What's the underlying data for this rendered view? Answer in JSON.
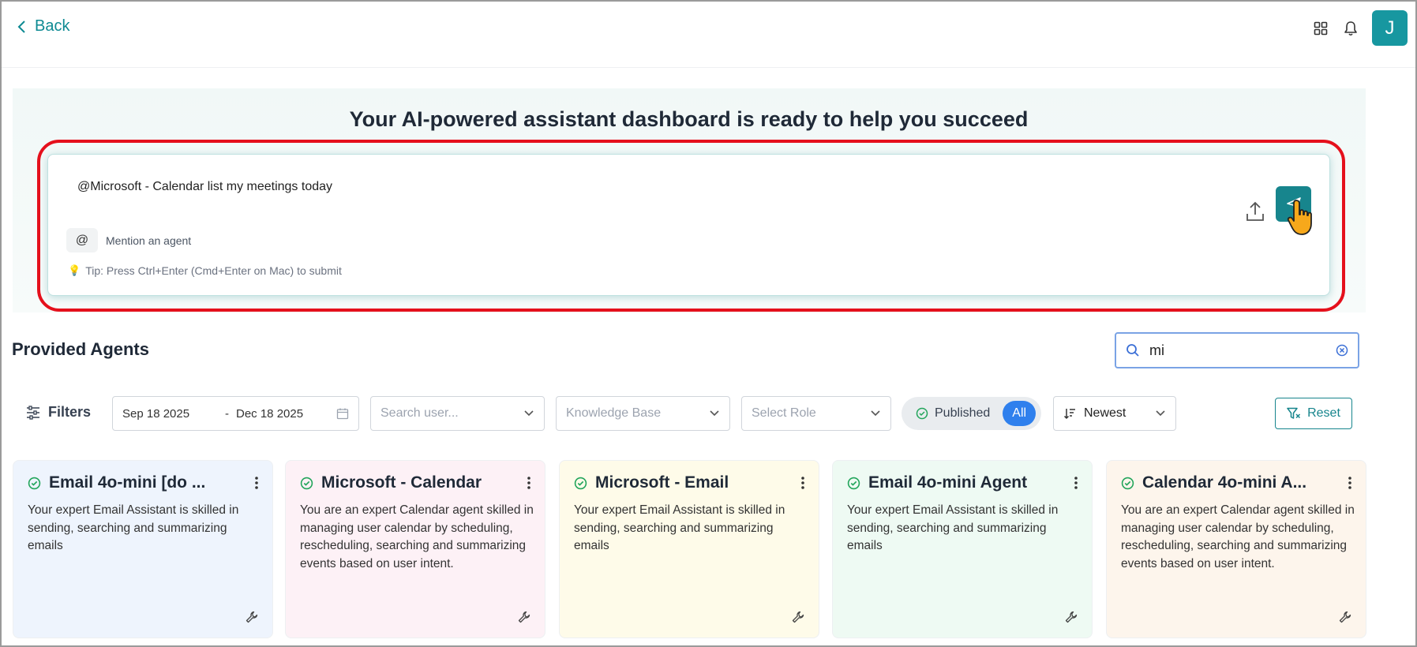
{
  "header": {
    "back_label": "Back",
    "avatar_initial": "J",
    "icons": [
      "grid-icon",
      "bell-icon"
    ]
  },
  "hero": {
    "title": "Your AI-powered assistant dashboard is ready to help you succeed",
    "composer_value": "@Microsoft - Calendar list my meetings today",
    "mention_symbol": "@",
    "mention_label": "Mention an agent",
    "tip": "Tip: Press Ctrl+Enter (Cmd+Enter on Mac) to submit"
  },
  "agents_section": {
    "title": "Provided Agents",
    "search_value": "mi"
  },
  "filters": {
    "label": "Filters",
    "date_start": "Sep 18 2025",
    "date_separator": "-",
    "date_end": "Dec 18 2025",
    "user_placeholder": "Search user...",
    "kb_placeholder": "Knowledge Base",
    "role_placeholder": "Select Role",
    "published_label": "Published",
    "all_label": "All",
    "sort_value": "Newest",
    "reset_label": "Reset"
  },
  "cards": [
    {
      "title": "Email 4o-mini [do ...",
      "description": "Your expert Email Assistant is skilled in sending, searching and summarizing emails",
      "bg": "#eef4fd"
    },
    {
      "title": "Microsoft - Calendar",
      "description": "You are an expert Calendar agent skilled in managing user calendar by scheduling, rescheduling, searching and summarizing events based on user intent.",
      "bg": "#fdf1f6"
    },
    {
      "title": "Microsoft - Email",
      "description": "Your expert Email Assistant is skilled in sending, searching and summarizing emails",
      "bg": "#fefbe9"
    },
    {
      "title": "Email 4o-mini Agent",
      "description": "Your expert Email Assistant is skilled in sending, searching and summarizing emails",
      "bg": "#eefaf3"
    },
    {
      "title": "Calendar 4o-mini A...",
      "description": "You are an expert Calendar agent skilled in managing user calendar by scheduling, rescheduling, searching and summarizing events based on user intent.",
      "bg": "#fdf5ec"
    }
  ],
  "colors": {
    "accent": "#17858d",
    "highlight": "#e5101c",
    "status_green": "#22a55b",
    "toggle_blue": "#2f80ed"
  }
}
